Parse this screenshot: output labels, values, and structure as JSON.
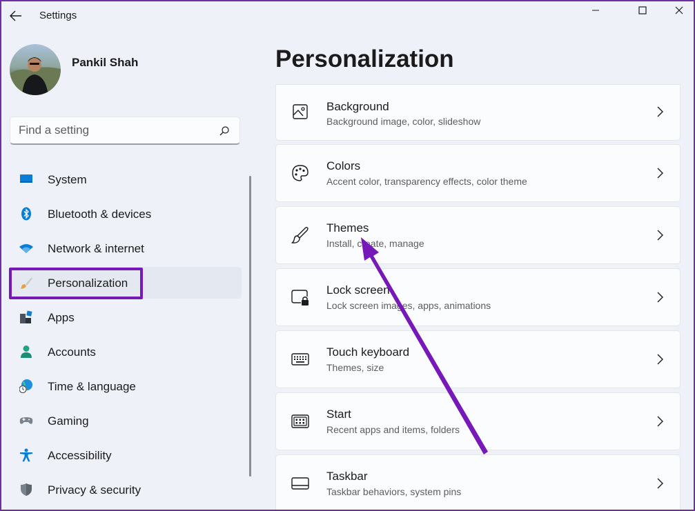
{
  "window": {
    "title": "Settings",
    "controls": {
      "minimize": "minimize",
      "maximize": "maximize",
      "close": "close"
    }
  },
  "profile": {
    "name": "Pankil Shah"
  },
  "search": {
    "placeholder": "Find a setting"
  },
  "sidebar": {
    "items": [
      {
        "label": "System",
        "icon": "monitor-icon"
      },
      {
        "label": "Bluetooth & devices",
        "icon": "bluetooth-icon"
      },
      {
        "label": "Network & internet",
        "icon": "wifi-icon"
      },
      {
        "label": "Personalization",
        "icon": "brush-icon",
        "selected": true
      },
      {
        "label": "Apps",
        "icon": "apps-icon"
      },
      {
        "label": "Accounts",
        "icon": "person-icon"
      },
      {
        "label": "Time & language",
        "icon": "globe-clock-icon"
      },
      {
        "label": "Gaming",
        "icon": "gamepad-icon"
      },
      {
        "label": "Accessibility",
        "icon": "accessibility-icon"
      },
      {
        "label": "Privacy & security",
        "icon": "shield-icon"
      }
    ]
  },
  "main": {
    "title": "Personalization",
    "cards": [
      {
        "title": "Background",
        "subtitle": "Background image, color, slideshow",
        "icon": "image-icon"
      },
      {
        "title": "Colors",
        "subtitle": "Accent color, transparency effects, color theme",
        "icon": "palette-icon"
      },
      {
        "title": "Themes",
        "subtitle": "Install, create, manage",
        "icon": "paintbrush-icon"
      },
      {
        "title": "Lock screen",
        "subtitle": "Lock screen images, apps, animations",
        "icon": "lock-screen-icon"
      },
      {
        "title": "Touch keyboard",
        "subtitle": "Themes, size",
        "icon": "keyboard-icon"
      },
      {
        "title": "Start",
        "subtitle": "Recent apps and items, folders",
        "icon": "start-icon"
      },
      {
        "title": "Taskbar",
        "subtitle": "Taskbar behaviors, system pins",
        "icon": "taskbar-icon"
      }
    ]
  },
  "colors": {
    "accent": "#0067c0",
    "annotation": "#7719b8",
    "background": "#eef1f8",
    "card": "#fbfcfe"
  }
}
